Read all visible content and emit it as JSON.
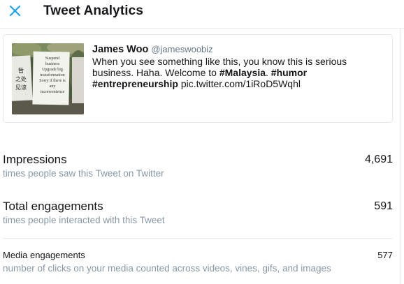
{
  "header": {
    "title": "Tweet Analytics"
  },
  "tweet": {
    "author_name": "James Woo",
    "author_handle": "@jameswoobiz",
    "text_line1": "When you see something like this, you know this is serious",
    "text_line2_pre": "business. Haha. Welcome to ",
    "hashtag_malaysia": "#Malaysia",
    "text_line2_mid": ". ",
    "hashtag_humor": "#humor",
    "hashtag_entrepreneurship": "#entrepreneurship",
    "link": " pic.twitter.com/1iRoD5Wqhl",
    "media_sign_lines": [
      "Suspend",
      "business",
      "Upgrade big",
      "transformation",
      "Sorry if there is",
      "any",
      "inconvenience"
    ],
    "media_chinese_lines": [
      "暂",
      "之处",
      "见谅"
    ]
  },
  "metrics": {
    "impressions": {
      "label": "Impressions",
      "value": "4,691",
      "desc": "times people saw this Tweet on Twitter"
    },
    "engagements": {
      "label": "Total engagements",
      "value": "591",
      "desc": "times people interacted with this Tweet"
    },
    "media_engagements": {
      "label": "Media engagements",
      "value": "577",
      "desc": "number of clicks on your media counted across videos, vines, gifs, and images"
    }
  },
  "colors": {
    "accent": "#1da1f2",
    "text_primary": "#14171a",
    "text_secondary": "#8899a6",
    "border": "#e1e8ed"
  },
  "icons": {
    "close": "close-icon"
  }
}
